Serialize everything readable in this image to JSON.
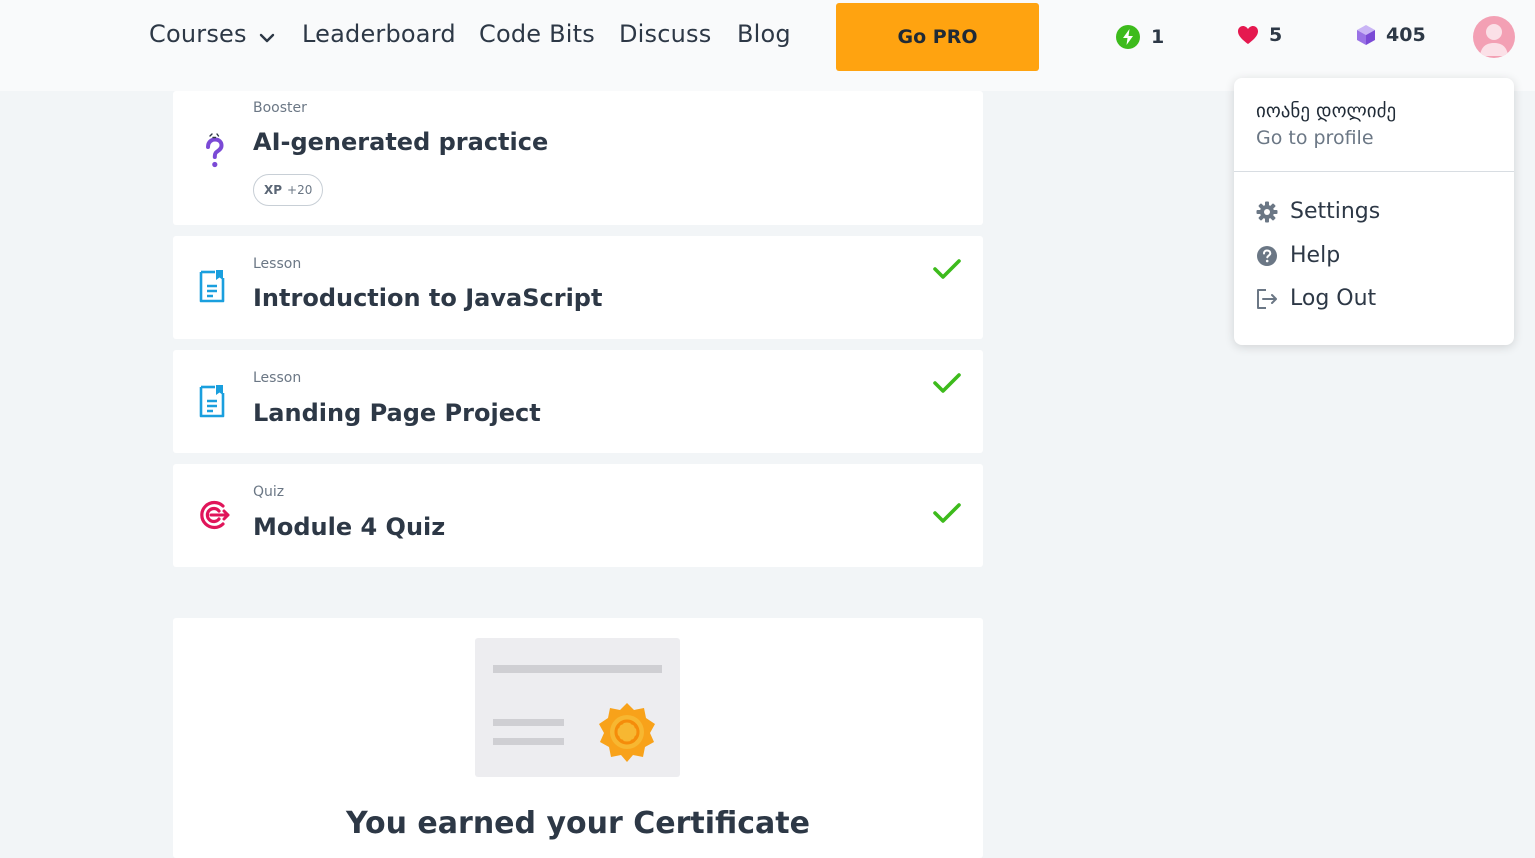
{
  "nav": {
    "courses": "Courses",
    "leaderboard": "Leaderboard",
    "code_bits": "Code Bits",
    "discuss": "Discuss",
    "blog": "Blog",
    "go_pro": "Go PRO"
  },
  "stats": {
    "streak": "1",
    "hearts": "5",
    "gems": "405"
  },
  "colors": {
    "accent": "#ffa310",
    "check": "#3dbb1c",
    "heart": "#e5194f",
    "lesson_icon": "#1a9fde",
    "quiz_icon": "#e0155a",
    "booster_icon": "#7b4ad6"
  },
  "items": [
    {
      "kind": "Booster",
      "title": "AI-generated practice",
      "xp_label": "XP",
      "xp_value": "+20",
      "icon": "question-mark-icon"
    },
    {
      "kind": "Lesson",
      "title": "Introduction to JavaScript",
      "icon": "lesson-icon",
      "done": true
    },
    {
      "kind": "Lesson",
      "title": "Landing Page Project",
      "icon": "lesson-icon",
      "done": true
    },
    {
      "kind": "Quiz",
      "title": "Module 4 Quiz",
      "icon": "target-icon",
      "done": true
    }
  ],
  "certificate": {
    "title": "You earned your Certificate"
  },
  "profile_menu": {
    "name": "იოანე დოლიძე",
    "go_to_profile": "Go to profile",
    "settings": "Settings",
    "help": "Help",
    "logout": "Log Out"
  }
}
